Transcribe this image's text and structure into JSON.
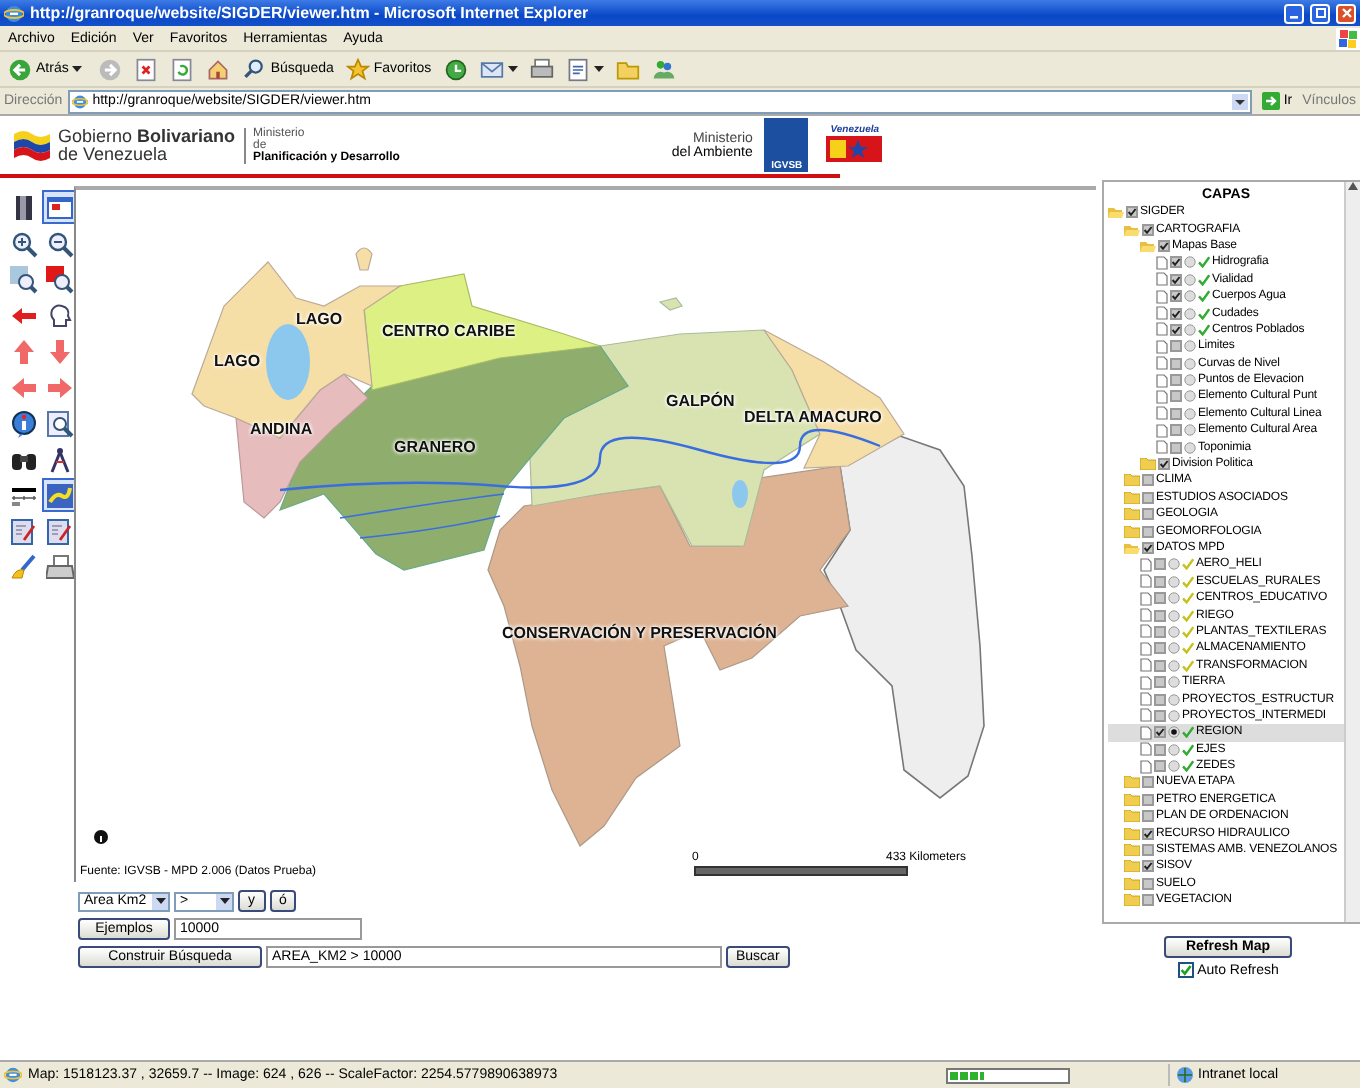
{
  "browser": {
    "title": "http://granroque/website/SIGDER/viewer.htm - Microsoft Internet Explorer",
    "menu": [
      "Archivo",
      "Edición",
      "Ver",
      "Favoritos",
      "Herramientas",
      "Ayuda"
    ],
    "toolbar": [
      {
        "kind": "back",
        "label": "Atrás"
      },
      {
        "kind": "forward"
      },
      {
        "kind": "stop"
      },
      {
        "kind": "refresh"
      },
      {
        "kind": "home"
      },
      {
        "kind": "search",
        "label": "Búsqueda"
      },
      {
        "kind": "favorites",
        "label": "Favoritos"
      },
      {
        "kind": "history"
      },
      {
        "kind": "mail"
      },
      {
        "kind": "print"
      },
      {
        "kind": "edit"
      },
      {
        "kind": "folder"
      },
      {
        "kind": "messenger"
      }
    ],
    "address_label": "Dirección",
    "url": "http://granroque/website/SIGDER/viewer.htm",
    "go": "Ir",
    "links": "Vínculos"
  },
  "header": {
    "government": [
      "Gobierno **Bolivariano**",
      "de Venezuela"
    ],
    "ministry": [
      "Ministerio",
      "de",
      "Planificación y Desarrollo"
    ],
    "environment": [
      "Ministerio",
      "del Ambiente"
    ],
    "igvsb": "IGVSB",
    "venezuela": "Venezuela"
  },
  "tools": [
    {
      "kind": "layers",
      "selected": false
    },
    {
      "kind": "overview",
      "selected": true
    },
    {
      "kind": "zoom_in",
      "selected": false
    },
    {
      "kind": "zoom_out",
      "selected": false
    },
    {
      "kind": "full_extent",
      "selected": false
    },
    {
      "kind": "zoom_selection",
      "selected": false
    },
    {
      "kind": "back",
      "selected": false
    },
    {
      "kind": "head",
      "selected": false
    },
    {
      "kind": "up",
      "selected": false
    },
    {
      "kind": "down",
      "selected": false
    },
    {
      "kind": "left",
      "selected": false
    },
    {
      "kind": "right",
      "selected": false
    },
    {
      "kind": "identify",
      "selected": false
    },
    {
      "kind": "query",
      "selected": false
    },
    {
      "kind": "find",
      "selected": false
    },
    {
      "kind": "measure",
      "selected": false
    },
    {
      "kind": "scalebar",
      "selected": false
    },
    {
      "kind": "line",
      "selected": true
    },
    {
      "kind": "select",
      "selected": false
    },
    {
      "kind": "select",
      "selected": false
    },
    {
      "kind": "clear",
      "selected": false
    },
    {
      "kind": "print",
      "selected": false
    }
  ],
  "map": {
    "labels": [
      "LAGO",
      "LAGO",
      "CENTRO CARIBE",
      "ANDINA",
      "GRANERO",
      "GALPÓN",
      "DELTA AMACURO",
      "CONSERVACIÓN Y PRESERVACIÓN"
    ],
    "source": "Fuente: IGVSB - MPD 2.006 (Datos Prueba)",
    "scale": [
      "0",
      "433 Kilometers"
    ]
  },
  "query": {
    "field": "Area Km2",
    "operator": ">",
    "and_button": "y",
    "or_button": "ó",
    "examples_button": "Ejemplos",
    "value": "10000",
    "build_button": "Construir Búsqueda",
    "expression": "AREA_KM2 > 10000",
    "search_button": "Buscar"
  },
  "layers": {
    "title": "CAPAS",
    "tree": [
      {
        "kind": "folder",
        "label": "SIGDER",
        "expanded": true,
        "checked": true,
        "children": [
          {
            "kind": "folder",
            "label": "CARTOGRAFIA",
            "expanded": true,
            "checked": true,
            "children": [
              {
                "kind": "folder",
                "label": "Mapas Base",
                "expanded": true,
                "checked": true,
                "children": [
                  {
                    "kind": "layer",
                    "label": "Hidrografia",
                    "checked": true,
                    "selected": false,
                    "visible": true,
                    "color": "#33aa33"
                  },
                  {
                    "kind": "layer",
                    "label": "Vialidad",
                    "checked": true,
                    "selected": false,
                    "visible": true,
                    "color": "#33aa33"
                  },
                  {
                    "kind": "layer",
                    "label": "Cuerpos Agua",
                    "checked": true,
                    "selected": false,
                    "visible": true,
                    "color": "#33aa33"
                  },
                  {
                    "kind": "layer",
                    "label": "Cudades",
                    "checked": true,
                    "selected": false,
                    "visible": true,
                    "color": "#33aa33"
                  },
                  {
                    "kind": "layer",
                    "label": "Centros Poblados",
                    "checked": true,
                    "selected": false,
                    "visible": true,
                    "color": "#33aa33"
                  },
                  {
                    "kind": "layer",
                    "label": "Limites",
                    "checked": false,
                    "selected": false,
                    "visible": false
                  },
                  {
                    "kind": "layer",
                    "label": "Curvas de Nivel",
                    "checked": false,
                    "selected": false,
                    "visible": false
                  },
                  {
                    "kind": "layer",
                    "label": "Puntos de Elevacion",
                    "checked": false,
                    "selected": false,
                    "visible": false
                  },
                  {
                    "kind": "layer",
                    "label": "Elemento Cultural Punt",
                    "checked": false,
                    "selected": false,
                    "visible": false
                  },
                  {
                    "kind": "layer",
                    "label": "Elemento Cultural Linea",
                    "checked": false,
                    "selected": false,
                    "visible": false
                  },
                  {
                    "kind": "layer",
                    "label": "Elemento Cultural Area",
                    "checked": false,
                    "selected": false,
                    "visible": false
                  },
                  {
                    "kind": "layer",
                    "label": "Toponimia",
                    "checked": false,
                    "selected": false,
                    "visible": false
                  }
                ]
              },
              {
                "kind": "folder",
                "label": "Division Politica",
                "expanded": false,
                "checked": true
              }
            ]
          },
          {
            "kind": "folder",
            "label": "CLIMA",
            "expanded": false,
            "checked": false
          },
          {
            "kind": "folder",
            "label": "ESTUDIOS ASOCIADOS",
            "expanded": false,
            "checked": false
          },
          {
            "kind": "folder",
            "label": "GEOLOGIA",
            "expanded": false,
            "checked": false
          },
          {
            "kind": "folder",
            "label": "GEOMORFOLOGIA",
            "expanded": false,
            "checked": false
          },
          {
            "kind": "folder",
            "label": "DATOS MPD",
            "expanded": true,
            "checked": true,
            "children": [
              {
                "kind": "layer",
                "label": "AERO_HELI",
                "checked": false,
                "selected": false,
                "visible": true,
                "color": "#c8c020"
              },
              {
                "kind": "layer",
                "label": "ESCUELAS_RURALES",
                "checked": false,
                "selected": false,
                "visible": true,
                "color": "#c8c020"
              },
              {
                "kind": "layer",
                "label": "CENTROS_EDUCATIVO",
                "checked": false,
                "selected": false,
                "visible": true,
                "color": "#c8c020"
              },
              {
                "kind": "layer",
                "label": "RIEGO",
                "checked": false,
                "selected": false,
                "visible": true,
                "color": "#c8c020"
              },
              {
                "kind": "layer",
                "label": "PLANTAS_TEXTILERAS",
                "checked": false,
                "selected": false,
                "visible": true,
                "color": "#c8c020"
              },
              {
                "kind": "layer",
                "label": "ALMACENAMIENTO",
                "checked": false,
                "selected": false,
                "visible": true,
                "color": "#c8c020"
              },
              {
                "kind": "layer",
                "label": "TRANSFORMACION",
                "checked": false,
                "selected": false,
                "visible": true,
                "color": "#c8c020"
              },
              {
                "kind": "layer",
                "label": "TIERRA",
                "checked": false,
                "selected": false,
                "visible": false
              },
              {
                "kind": "layer",
                "label": "PROYECTOS_ESTRUCTUR",
                "checked": false,
                "selected": false,
                "visible": false
              },
              {
                "kind": "layer",
                "label": "PROYECTOS_INTERMEDI",
                "checked": false,
                "selected": false,
                "visible": false
              },
              {
                "kind": "layer",
                "label": "REGION",
                "checked": true,
                "selected": true,
                "visible": true,
                "color": "#33aa33"
              },
              {
                "kind": "layer",
                "label": "EJES",
                "checked": false,
                "selected": false,
                "visible": true,
                "color": "#33aa33"
              },
              {
                "kind": "layer",
                "label": "ZEDES",
                "checked": false,
                "selected": false,
                "visible": true,
                "color": "#33aa33"
              }
            ]
          },
          {
            "kind": "folder",
            "label": "NUEVA ETAPA",
            "expanded": false,
            "checked": false
          },
          {
            "kind": "folder",
            "label": "PETRO ENERGETICA",
            "expanded": false,
            "checked": false
          },
          {
            "kind": "folder",
            "label": "PLAN DE ORDENACION",
            "expanded": false,
            "checked": false
          },
          {
            "kind": "folder",
            "label": "RECURSO HIDRAULICO",
            "expanded": false,
            "checked": true
          },
          {
            "kind": "folder",
            "label": "SISTEMAS AMB. VENEZOLANOS",
            "expanded": false,
            "checked": false
          },
          {
            "kind": "folder",
            "label": "SISOV",
            "expanded": false,
            "checked": true
          },
          {
            "kind": "folder",
            "label": "SUELO",
            "expanded": false,
            "checked": false
          },
          {
            "kind": "folder",
            "label": "VEGETACION",
            "expanded": false,
            "checked": false
          }
        ]
      }
    ],
    "refresh_button": "Refresh Map",
    "auto_refresh": {
      "label": "Auto Refresh",
      "checked": true
    }
  },
  "status_bar": {
    "text": "Map: 1518123.37 , 32659.7 -- Image: 624 , 626 -- ScaleFactor: 2254.5779890638973",
    "progress": {
      "level": 0.3
    },
    "zone": "Intranet local"
  }
}
